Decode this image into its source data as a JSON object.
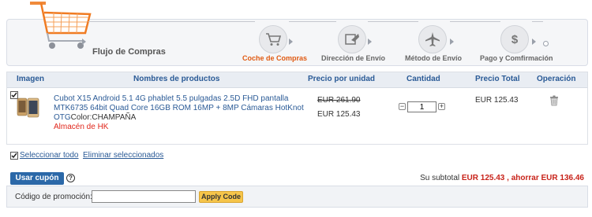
{
  "flow": {
    "title": "Flujo de Compras",
    "steps": [
      {
        "label": "Coche de Compras",
        "icon": "cart-icon",
        "active": true
      },
      {
        "label": "Dirección de Envío",
        "icon": "address-icon",
        "active": false
      },
      {
        "label": "Método de Envío",
        "icon": "plane-icon",
        "active": false
      },
      {
        "label": "Pago y Comfirmación",
        "icon": "dollar-icon",
        "active": false
      }
    ]
  },
  "table": {
    "headers": {
      "image": "Imagen",
      "name": "Nombres de productos",
      "unit_price": "Precio por unidad",
      "quantity": "Cantidad",
      "total": "Precio Total",
      "operation": "Operación"
    },
    "item": {
      "checked": true,
      "name": "Cubot X15 Android 5.1 4G phablet 5.5 pulgadas 2.5D FHD pantalla MTK6735 64bit Quad Core 16GB ROM 16MP + 8MP Cámaras HotKnot OTG",
      "color_label": "Color:",
      "color_value": "CHAMPAÑA",
      "warehouse": "Almacén de HK",
      "old_price": "EUR 261.90",
      "unit_price": "EUR 125.43",
      "quantity": "1",
      "qty_minus": "−",
      "qty_plus": "+",
      "total_price": "EUR 125.43"
    }
  },
  "selection": {
    "select_all": "Seleccionar todo",
    "delete_selected": "Eliminar seleccionados"
  },
  "coupon": {
    "button": "Usar cupón",
    "help": "?",
    "subtotal_label": "Su subtotal",
    "subtotal_value": "EUR 125.43",
    "savings_label": ", ahorrar",
    "savings_value": "EUR 136.46",
    "promo_label": "Código de promoción:",
    "promo_value": "",
    "apply": "Apply Code"
  },
  "colors": {
    "accent_orange": "#e05a12",
    "link_blue": "#2a5a96",
    "price_red": "#c8231a",
    "button_blue": "#2b68a8",
    "apply_yellow": "#f6c54a"
  }
}
